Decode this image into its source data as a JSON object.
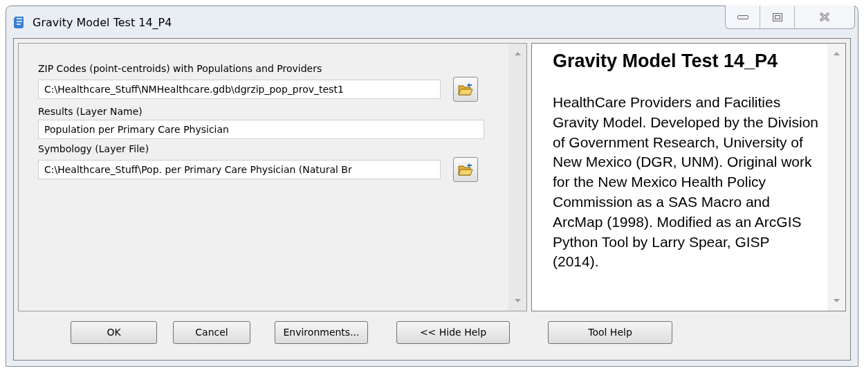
{
  "window": {
    "title": "Gravity Model Test 14_P4"
  },
  "parameters": [
    {
      "label": "ZIP Codes (point-centroids) with Populations and Providers",
      "value": "C:\\Healthcare_Stuff\\NMHealthcare.gdb\\dgrzip_pop_prov_test1",
      "browse": true
    },
    {
      "label": "Results (Layer Name)",
      "value": "Population per Primary Care Physician",
      "browse": false
    },
    {
      "label": "Symbology (Layer File)",
      "value": "C:\\Healthcare_Stuff\\Pop. per Primary Care Physician (Natural Br",
      "browse": true
    }
  ],
  "help": {
    "title": "Gravity Model Test 14_P4",
    "body": "HealthCare Providers and Facilities Gravity Model. Developed by the Division of Government Research, University of New Mexico (DGR, UNM). Original work for the New Mexico Health Policy Commission as a SAS Macro and ArcMap (1998). Modified as an ArcGIS Python Tool by Larry Spear, GISP (2014)."
  },
  "buttons": [
    "OK",
    "Cancel",
    "Environments...",
    "<< Hide Help",
    "Tool Help"
  ]
}
